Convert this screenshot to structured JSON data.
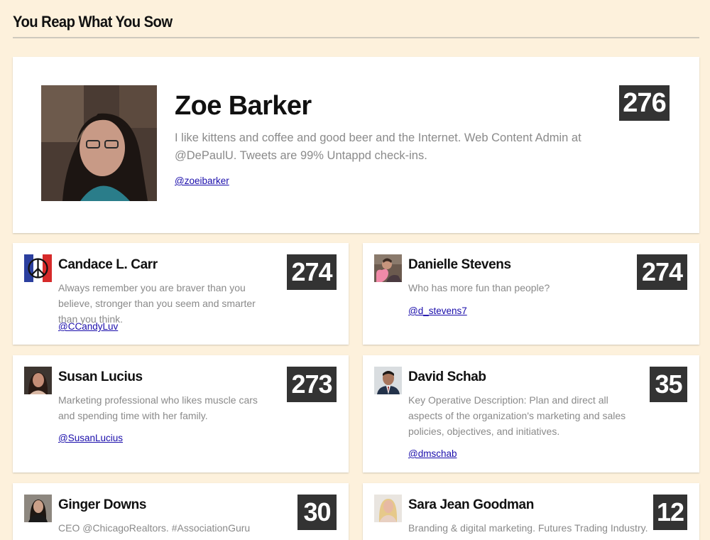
{
  "header": {
    "title": "You Reap What You Sow"
  },
  "featured": {
    "name": "Zoe Barker",
    "bio": "I like kittens and coffee and good beer and the Internet. Web Content Admin at @DePaulU. Tweets are 99% Untappd check-ins.",
    "handle": "@zoeibarker",
    "score": "276",
    "avatar": "profile-photo"
  },
  "cards": [
    {
      "name": "Candace L. Carr",
      "bio": "Always remember you are braver than you believe, stronger than you seem and smarter than you think.",
      "handle": "@CCandyLuv",
      "score": "274",
      "avatar": "peace-sign-flag"
    },
    {
      "name": "Danielle Stevens",
      "bio": "Who has more fun than people?",
      "handle": "@d_stevens7",
      "score": "274",
      "avatar": "heart-profile"
    },
    {
      "name": "Susan Lucius",
      "bio": "Marketing professional who likes muscle cars and spending time with her family.",
      "handle": "@SusanLucius",
      "score": "273",
      "avatar": "profile-photo"
    },
    {
      "name": "David Schab",
      "bio": "Key Operative Description: Plan and direct all aspects of the organization's marketing and sales policies, objectives, and initiatives.",
      "handle": "@dmschab",
      "score": "35",
      "avatar": "profile-photo"
    },
    {
      "name": "Ginger Downs",
      "bio": "CEO @ChicagoRealtors. #AssociationGuru #OldLadyWisdom #RealEstateJunkie Making homelessness",
      "handle": "",
      "score": "30",
      "avatar": "profile-photo"
    },
    {
      "name": "Sara Jean Goodman",
      "bio": "Branding & digital marketing. Futures Trading Industry. Impromptu, real, honest... things that enlighten me. Director of",
      "handle": "",
      "score": "12",
      "avatar": "profile-photo"
    }
  ]
}
